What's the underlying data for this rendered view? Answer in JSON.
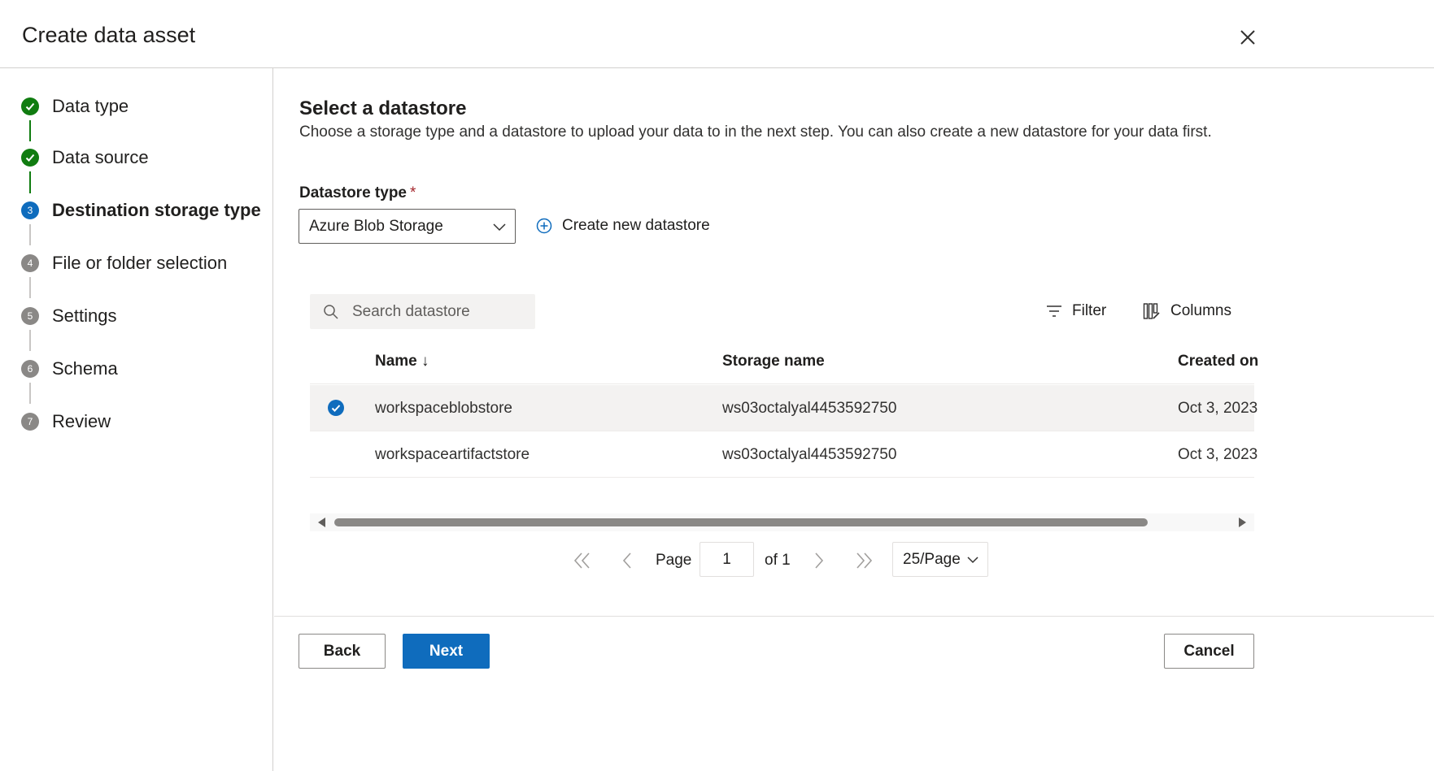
{
  "dialog": {
    "title": "Create data asset"
  },
  "steps": [
    {
      "label": "Data type",
      "status": "done",
      "number": "1"
    },
    {
      "label": "Data source",
      "status": "done",
      "number": "2"
    },
    {
      "label": "Destination storage type",
      "status": "current",
      "number": "3"
    },
    {
      "label": "File or folder selection",
      "status": "pending",
      "number": "4"
    },
    {
      "label": "Settings",
      "status": "pending",
      "number": "5"
    },
    {
      "label": "Schema",
      "status": "pending",
      "number": "6"
    },
    {
      "label": "Review",
      "status": "pending",
      "number": "7"
    }
  ],
  "section": {
    "title": "Select a datastore",
    "description": "Choose a storage type and a datastore to upload your data to in the next step. You can also create a new datastore for your data first."
  },
  "datastore_type": {
    "label": "Datastore type",
    "required_mark": "*",
    "value": "Azure Blob Storage"
  },
  "create_datastore_label": "Create new datastore",
  "search": {
    "placeholder": "Search datastore"
  },
  "toolbar": {
    "filter_label": "Filter",
    "columns_label": "Columns"
  },
  "table": {
    "columns": [
      "Name ↓",
      "Storage name",
      "Created on"
    ],
    "rows": [
      {
        "name": "workspaceblobstore",
        "storage": "ws03octalyal4453592750",
        "created": "Oct 3, 2023",
        "selected": true
      },
      {
        "name": "workspaceartifactstore",
        "storage": "ws03octalyal4453592750",
        "created": "Oct 3, 2023",
        "selected": false
      }
    ]
  },
  "pagination": {
    "page_label": "Page",
    "page_value": "1",
    "of_label": "of 1",
    "page_size": "25/Page"
  },
  "buttons": {
    "back": "Back",
    "next": "Next",
    "cancel": "Cancel"
  },
  "colors": {
    "accent": "#0f6cbd",
    "done": "#107c10",
    "pending": "#8a8886"
  }
}
